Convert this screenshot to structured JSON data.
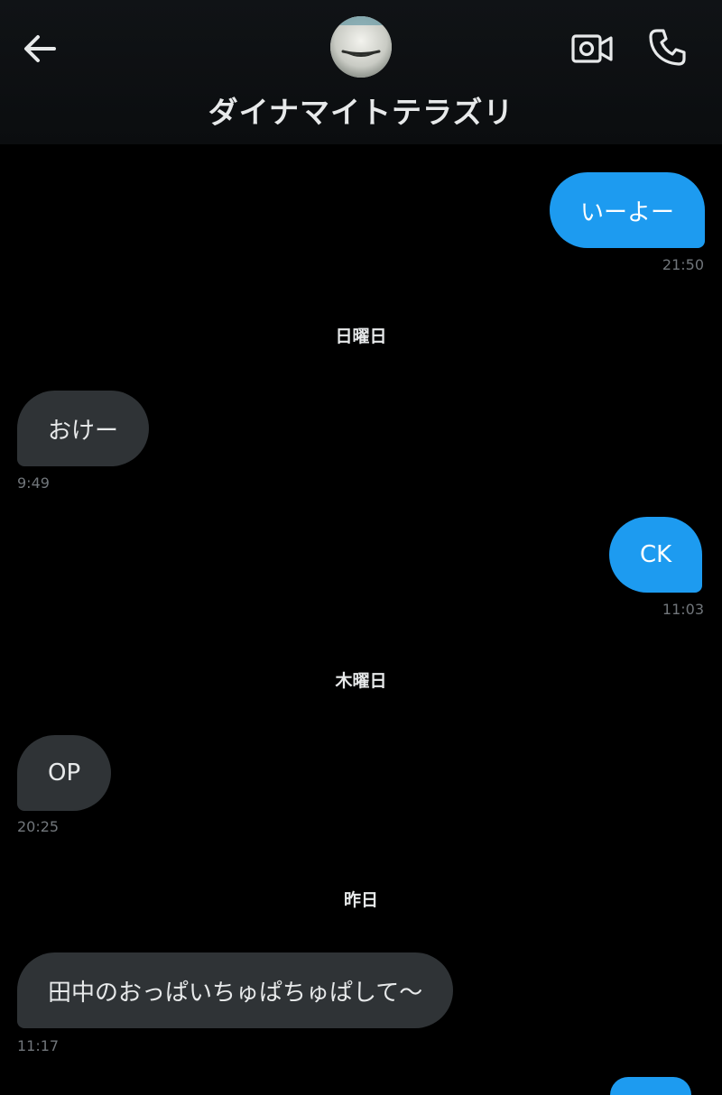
{
  "header": {
    "contact_name": "ダイナマイトテラズリ"
  },
  "messages": [
    {
      "direction": "out",
      "text": "いーよー",
      "time": "21:50"
    },
    {
      "type": "day",
      "label": "日曜日"
    },
    {
      "direction": "in",
      "text": "おけー",
      "time": "9:49"
    },
    {
      "direction": "out",
      "text": "CK",
      "time": "11:03"
    },
    {
      "type": "day",
      "label": "木曜日"
    },
    {
      "direction": "in",
      "text": "OP",
      "time": "20:25"
    },
    {
      "type": "day",
      "label": "昨日"
    },
    {
      "direction": "in",
      "text": "田中のおっぱいちゅぱちゅぱして〜",
      "time": "11:17"
    }
  ],
  "colors": {
    "background": "#000000",
    "outgoing_bubble": "#1d9bf0",
    "incoming_bubble": "#2f3336",
    "timestamp": "#71767b",
    "text": "#e7e9ea"
  },
  "icons": {
    "back": "arrow-left-icon",
    "video_call": "video-camera-icon",
    "voice_call": "phone-icon"
  }
}
